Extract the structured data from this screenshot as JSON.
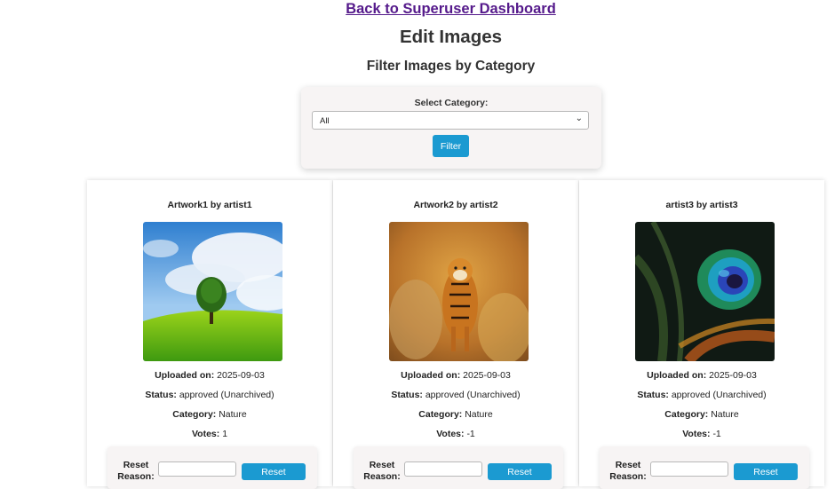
{
  "nav": {
    "back_link": "Back to Superuser Dashboard"
  },
  "page": {
    "title": "Edit Images",
    "filter_heading": "Filter Images by Category"
  },
  "filter": {
    "label": "Select Category:",
    "selected": "All",
    "button": "Filter"
  },
  "labels": {
    "uploaded": "Uploaded on:",
    "status": "Status:",
    "category": "Category:",
    "votes": "Votes:",
    "reset_reason": "Reset Reason:",
    "reset_button": "Reset"
  },
  "cards": [
    {
      "title": "Artwork1 by artist1",
      "image": "landscape-tree-image",
      "uploaded": "2025-09-03",
      "status": "approved (Unarchived)",
      "category": "Nature",
      "votes": "1"
    },
    {
      "title": "Artwork2 by artist2",
      "image": "tiger-image",
      "uploaded": "2025-09-03",
      "status": "approved (Unarchived)",
      "category": "Nature",
      "votes": "-1"
    },
    {
      "title": "artist3 by artist3",
      "image": "peacock-feather-image",
      "uploaded": "2025-09-03",
      "status": "approved (Unarchived)",
      "category": "Nature",
      "votes": "-1"
    }
  ],
  "colors": {
    "link": "#551a8b",
    "button": "#1b9ad1",
    "panel": "#f7f4f4"
  }
}
